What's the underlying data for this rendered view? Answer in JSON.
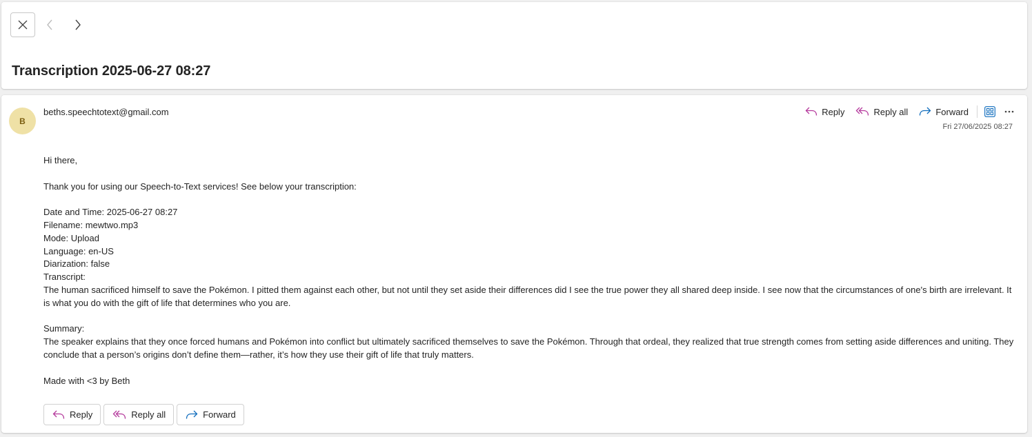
{
  "subject": "Transcription 2025-06-27 08:27",
  "sender": {
    "avatar_initial": "B",
    "email": "beths.speechtotext@gmail.com",
    "date": "Fri 27/06/2025 08:27"
  },
  "actions": {
    "reply": "Reply",
    "reply_all": "Reply all",
    "forward": "Forward"
  },
  "body": {
    "greeting": "Hi there,",
    "intro": "Thank you for using our Speech-to-Text services! See below your transcription:",
    "date_time": "Date and Time: 2025-06-27 08:27",
    "filename": "Filename: mewtwo.mp3",
    "mode": "Mode: Upload",
    "language": "Language: en-US",
    "diarization": "Diarization: false",
    "transcript_label": "Transcript:",
    "transcript": "The human sacrificed himself to save the Pokémon. I pitted them against each other, but not until they set aside their differences did I see the true power they all shared deep inside. I see now that the circumstances of one's birth are irrelevant. It is what you do with the gift of life that determines who you are.",
    "summary_label": "Summary:",
    "summary": "The speaker explains that they once forced humans and Pokémon into conflict but ultimately sacrificed themselves to save the Pokémon. Through that ordeal, they realized that true strength comes from setting aside differences and uniting. They conclude that a person’s origins don’t define them—rather, it’s how they use their gift of life that truly matters.",
    "signature": "Made with <3 by Beth"
  },
  "colors": {
    "reply_icon": "#b4399c",
    "forward_icon": "#0f6cbd",
    "avatar_bg": "#efe1a6",
    "avatar_text": "#7a5d10"
  }
}
